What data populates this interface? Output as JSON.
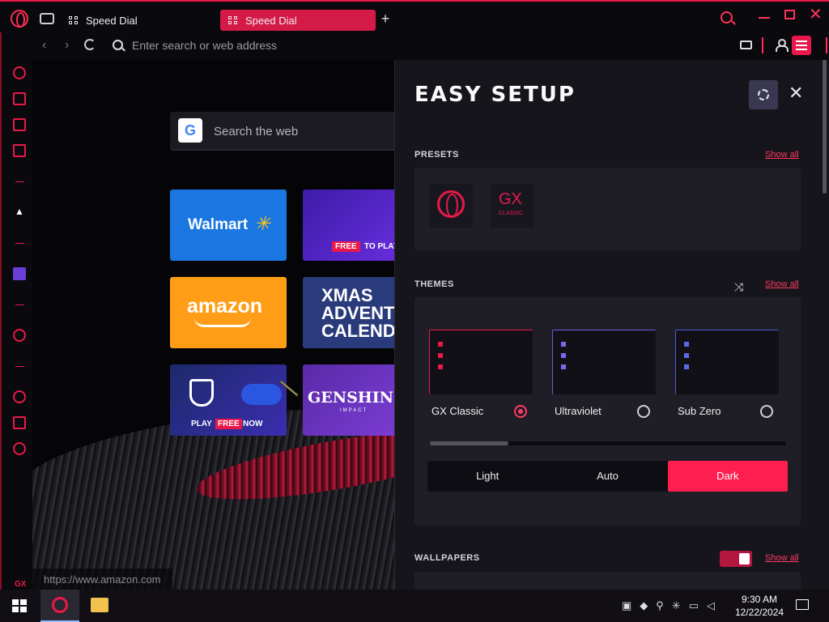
{
  "tabs": [
    {
      "label": "Speed Dial",
      "active": false
    },
    {
      "label": "Speed Dial",
      "active": true
    }
  ],
  "address_bar": {
    "placeholder": "Enter search or web address"
  },
  "speed_dial": {
    "search_placeholder": "Search the web",
    "google_letter": "G",
    "tiles": {
      "walmart": "Walmart",
      "game_free": "FREE",
      "game_to_play": "TO PLAY",
      "amazon": "amazon",
      "xmas_line1": "XMAS",
      "xmas_line2": "ADVENT",
      "xmas_line3": "CALENDAR",
      "wows_play": "PLAY",
      "wows_free": "FREE",
      "wows_now": "NOW",
      "genshin": "GENSHIN",
      "genshin_sub": "IMPACT"
    }
  },
  "status_url": "https://www.amazon.com",
  "sidebar": {
    "gx_label": "GX",
    "more_label": "•••"
  },
  "easy_setup": {
    "title": "EASY SETUP",
    "presets": {
      "label": "PRESETS",
      "show_all": "Show all",
      "gx_logo": "GX",
      "gx_classic": "CLASSIC"
    },
    "themes": {
      "label": "THEMES",
      "show_all": "Show all",
      "items": [
        {
          "name": "GX Classic",
          "selected": true
        },
        {
          "name": "Ultraviolet",
          "selected": false
        },
        {
          "name": "Sub Zero",
          "selected": false
        }
      ],
      "slider_level": 0.22,
      "modes": [
        "Light",
        "Auto",
        "Dark"
      ],
      "active_mode": "Dark"
    },
    "wallpapers": {
      "label": "WALLPAPERS",
      "show_all": "Show all",
      "enabled": true
    }
  },
  "taskbar": {
    "time": "9:30 AM",
    "date": "12/22/2024"
  },
  "colors": {
    "accent": "#ff1e50",
    "panel_bg": "#16151c",
    "page_bg": "#050407"
  }
}
